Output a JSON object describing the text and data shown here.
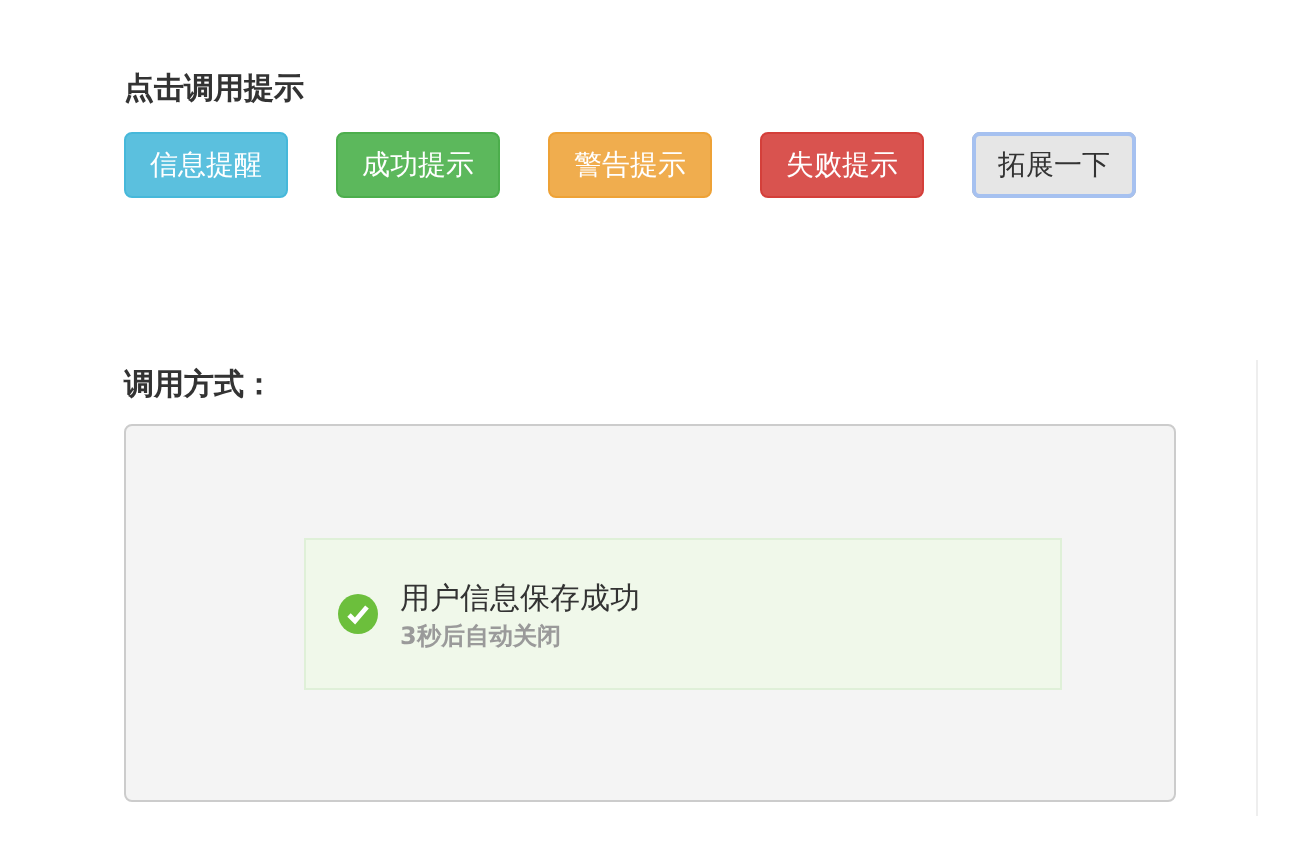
{
  "demo_heading": "点击调用提示",
  "buttons": [
    {
      "label": "信息提醒",
      "kind": "info",
      "focused": false
    },
    {
      "label": "成功提示",
      "kind": "success",
      "focused": false
    },
    {
      "label": "警告提示",
      "kind": "warning",
      "focused": false
    },
    {
      "label": "失败提示",
      "kind": "danger",
      "focused": false
    },
    {
      "label": "拓展一下",
      "kind": "default",
      "focused": true
    }
  ],
  "usage_heading": "调用方式：",
  "toast": {
    "kind": "success",
    "title": "用户信息保存成功",
    "subtitle": "3秒后自动关闭"
  }
}
